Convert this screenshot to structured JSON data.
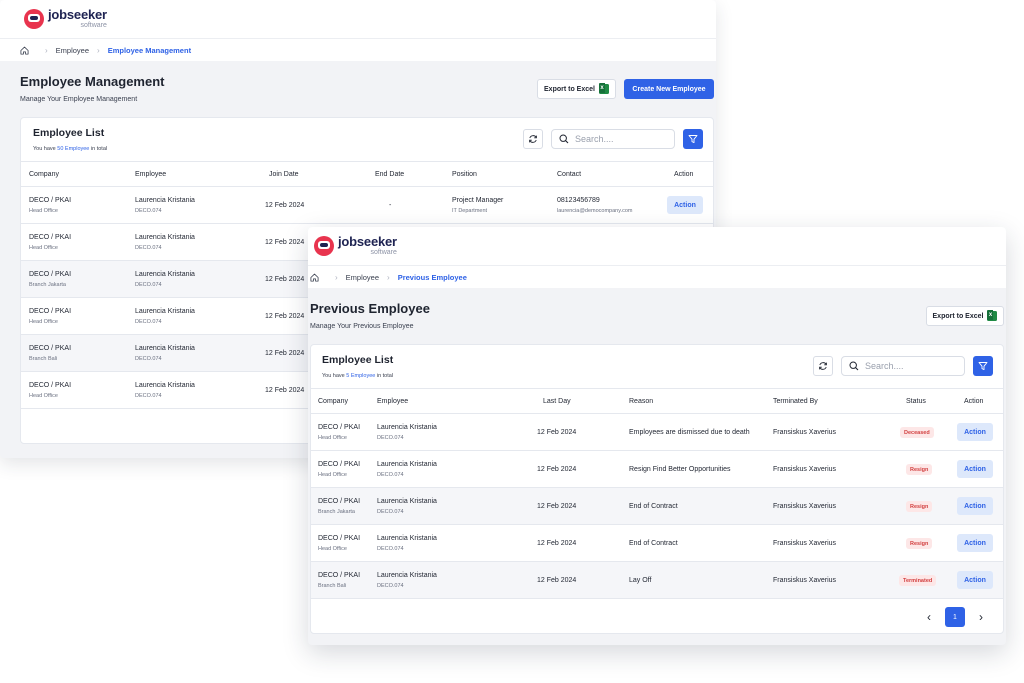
{
  "brand": {
    "name": "jobseeker",
    "sub": "software"
  },
  "colors": {
    "accent": "#2f62e6",
    "brand": "#e8344e",
    "danger": "#d23f3f"
  },
  "w1": {
    "breadcrumb": [
      "Employee",
      "Employee Management"
    ],
    "title": "Employee Management",
    "subtitle": "Manage Your Employee Management",
    "export_label": "Export to Excel",
    "create_label": "Create New Employee",
    "list_title": "Employee List",
    "count_pre": "You have ",
    "count_hl": "50 Employee",
    "count_post": " in total",
    "search_placeholder": "Search....",
    "columns": [
      "Company",
      "Employee",
      "Join Date",
      "End Date",
      "Position",
      "Contact",
      "Action"
    ],
    "rows": [
      {
        "company": "DECO / PKAI",
        "office": "Head Office",
        "name": "Laurencia Kristania",
        "id": "DECO.074",
        "join": "12 Feb 2024",
        "end": "-",
        "position": "Project Manager",
        "dept": "IT Department",
        "phone": "08123456789",
        "email": "laurencia@democompany.com",
        "action": "Action"
      },
      {
        "company": "DECO / PKAI",
        "office": "Head Office",
        "name": "Laurencia Kristania",
        "id": "DECO.074",
        "join": "12 Feb 2024"
      },
      {
        "company": "DECO / PKAI",
        "office": "Branch Jakarta",
        "name": "Laurencia Kristania",
        "id": "DECO.074",
        "join": "12 Feb 2024"
      },
      {
        "company": "DECO / PKAI",
        "office": "Head Office",
        "name": "Laurencia Kristania",
        "id": "DECO.074",
        "join": "12 Feb 2024"
      },
      {
        "company": "DECO / PKAI",
        "office": "Branch Bali",
        "name": "Laurencia Kristania",
        "id": "DECO.074",
        "join": "12 Feb 2024"
      },
      {
        "company": "DECO / PKAI",
        "office": "Head Office",
        "name": "Laurencia Kristania",
        "id": "DECO.074",
        "join": "12 Feb 2024"
      }
    ]
  },
  "w2": {
    "breadcrumb": [
      "Employee",
      "Previous Employee"
    ],
    "title": "Previous Employee",
    "subtitle": "Manage Your Previous Employee",
    "export_label": "Export to Excel",
    "list_title": "Employee List",
    "count_pre": "You have ",
    "count_hl": "5 Employee",
    "count_post": " in total",
    "search_placeholder": "Search....",
    "columns": [
      "Company",
      "Employee",
      "Last Day",
      "Reason",
      "Terminated By",
      "Status",
      "Action"
    ],
    "rows": [
      {
        "company": "DECO / PKAI",
        "office": "Head Office",
        "name": "Laurencia Kristania",
        "id": "DECO.074",
        "last": "12 Feb 2024",
        "reason": "Employees are dismissed due to death",
        "by": "Fransiskus Xaverius",
        "status": "Deceased",
        "action": "Action"
      },
      {
        "company": "DECO / PKAI",
        "office": "Head Office",
        "name": "Laurencia Kristania",
        "id": "DECO.074",
        "last": "12 Feb 2024",
        "reason": "Resign Find Better Opportunities",
        "by": "Fransiskus Xaverius",
        "status": "Resign",
        "action": "Action"
      },
      {
        "company": "DECO / PKAI",
        "office": "Branch Jakarta",
        "name": "Laurencia Kristania",
        "id": "DECO.074",
        "last": "12 Feb 2024",
        "reason": "End of Contract",
        "by": "Fransiskus Xaverius",
        "status": "Resign",
        "action": "Action"
      },
      {
        "company": "DECO / PKAI",
        "office": "Head Office",
        "name": "Laurencia Kristania",
        "id": "DECO.074",
        "last": "12 Feb 2024",
        "reason": "End of Contract",
        "by": "Fransiskus Xaverius",
        "status": "Resign",
        "action": "Action"
      },
      {
        "company": "DECO / PKAI",
        "office": "Branch Bali",
        "name": "Laurencia Kristania",
        "id": "DECO.074",
        "last": "12 Feb 2024",
        "reason": "Lay Off",
        "by": "Fransiskus Xaverius",
        "status": "Terminated",
        "action": "Action"
      }
    ],
    "page": "1"
  }
}
